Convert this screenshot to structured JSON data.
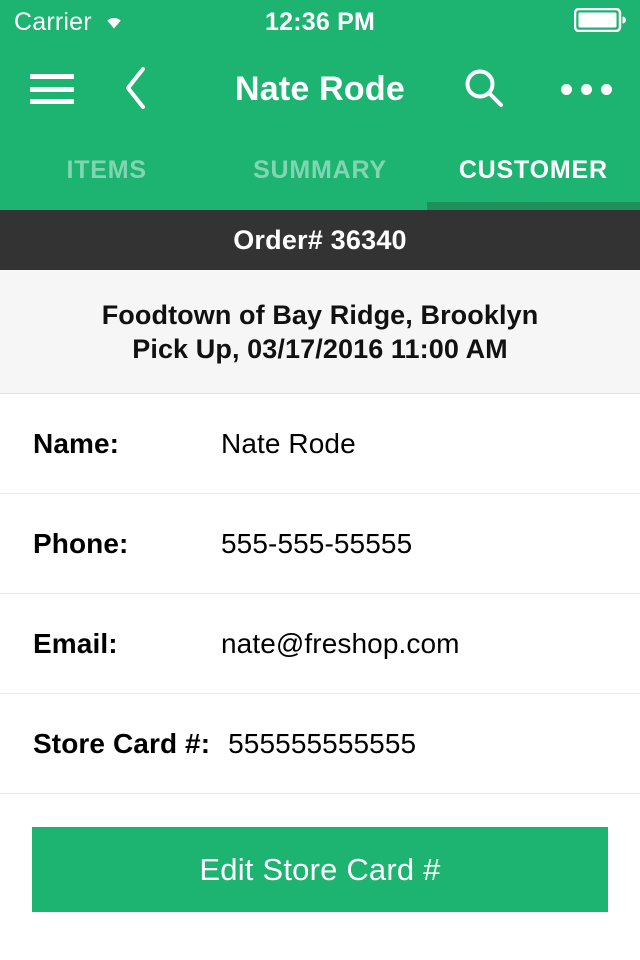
{
  "status_bar": {
    "carrier": "Carrier",
    "wifi_icon": "wifi-icon",
    "time": "12:36 PM",
    "battery_icon": "battery-full-icon"
  },
  "nav_bar": {
    "menu_icon": "hamburger-menu-icon",
    "back_icon": "chevron-left-icon",
    "title": "Nate Rode",
    "search_icon": "search-icon",
    "more_icon": "more-horizontal-icon"
  },
  "tabs": {
    "items": [
      {
        "label": "ITEMS",
        "active": false
      },
      {
        "label": "SUMMARY",
        "active": false
      },
      {
        "label": "CUSTOMER",
        "active": true
      }
    ],
    "active_index": 2
  },
  "order": {
    "label": "Order# 36340"
  },
  "store_info": {
    "name": "Foodtown of Bay Ridge, Brooklyn",
    "pickup": "Pick Up, 03/17/2016 11:00 AM"
  },
  "details": [
    {
      "label": "Name:",
      "value": "Nate Rode"
    },
    {
      "label": "Phone:",
      "value": "555-555-55555"
    },
    {
      "label": "Email:",
      "value": "nate@freshop.com"
    },
    {
      "label": "Store Card #:",
      "value": "555555555555"
    }
  ],
  "actions": {
    "edit_store_card": "Edit Store Card #"
  },
  "colors": {
    "brand_green": "#1DB371",
    "tab_indicator": "#1F8F5C",
    "order_bar": "#333333",
    "info_background": "#F6F6F6"
  }
}
